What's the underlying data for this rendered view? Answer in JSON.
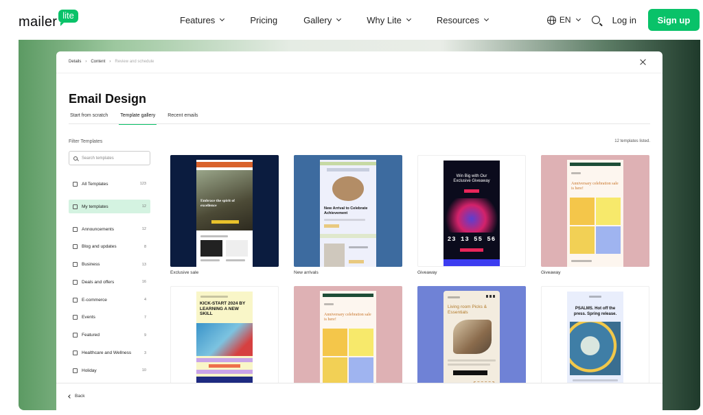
{
  "brand": {
    "word": "mailer",
    "badge": "lite"
  },
  "nav": {
    "items": [
      {
        "label": "Features",
        "dropdown": true
      },
      {
        "label": "Pricing",
        "dropdown": false
      },
      {
        "label": "Gallery",
        "dropdown": true
      },
      {
        "label": "Why Lite",
        "dropdown": true
      },
      {
        "label": "Resources",
        "dropdown": true
      }
    ],
    "lang": "EN",
    "login": "Log in",
    "signup": "Sign up"
  },
  "modal": {
    "breadcrumb": [
      "Details",
      "Content",
      "Review and schedule"
    ],
    "title": "Email Design",
    "tabs": [
      "Start from scratch",
      "Template gallery",
      "Recent emails"
    ],
    "active_tab": "Template gallery",
    "filter_label": "Filter Templates",
    "templates_listed": "12 templates listed.",
    "search_placeholder": "Search templates",
    "back": "Back"
  },
  "sidebar": [
    {
      "label": "All Templates",
      "count": "123",
      "icon": "folder-icon"
    },
    {
      "label": "My templates",
      "count": "12",
      "icon": "bookmark-icon",
      "active": true
    },
    {
      "label": "Announcements",
      "count": "12",
      "icon": "megaphone-icon"
    },
    {
      "label": "Blog and updates",
      "count": "8",
      "icon": "rss-icon"
    },
    {
      "label": "Business",
      "count": "13",
      "icon": "briefcase-icon"
    },
    {
      "label": "Deals and offers",
      "count": "16",
      "icon": "tag-icon"
    },
    {
      "label": "E-commerce",
      "count": "4",
      "icon": "cart-icon"
    },
    {
      "label": "Events",
      "count": "7",
      "icon": "calendar-icon"
    },
    {
      "label": "Featured",
      "count": "9",
      "icon": "star-icon"
    },
    {
      "label": "Healthcare and Wellness",
      "count": "3",
      "icon": "heart-icon"
    },
    {
      "label": "Holiday",
      "count": "10",
      "icon": "gift-icon"
    }
  ],
  "templates": [
    {
      "caption": "Exclusive sale",
      "bg": "#0b1c3f",
      "headline": "Embrace the spirit of excellence"
    },
    {
      "caption": "New arrivals",
      "bg": "#3d6b9f",
      "headline": "New Arrival to Celebrate Achievement"
    },
    {
      "caption": "Giveaway",
      "bg": "#ffffff",
      "headline": "Win Big with Our Exclusive Giveaway",
      "countdown": "23 13 55 56"
    },
    {
      "caption": "Giveaway",
      "bg": "#deb1b4",
      "headline": "Anniversary celebration sale is here!"
    },
    {
      "caption": "",
      "bg": "#ffffff",
      "headline": "KICK-START 2024 BY LEARNING A NEW SKILL"
    },
    {
      "caption": "",
      "bg": "#deb1b4",
      "headline": "Anniversary celebration sale is here!"
    },
    {
      "caption": "",
      "bg": "#6f82d6",
      "headline": "Living room Picks & Essentials"
    },
    {
      "caption": "",
      "bg": "#ffffff",
      "headline": "PSALMS. Hot off the press. Spring release."
    }
  ],
  "colors": {
    "accent": "#09c269",
    "active_bg": "#d4f3e1"
  }
}
